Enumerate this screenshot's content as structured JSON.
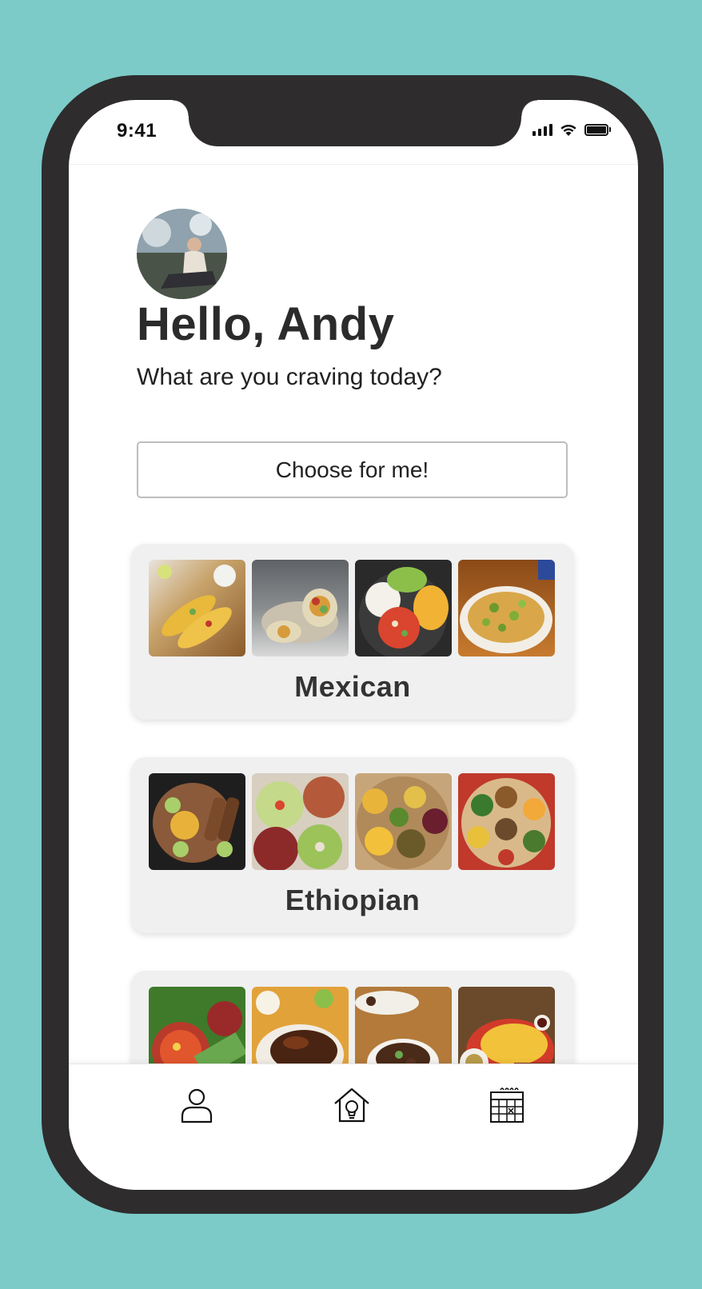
{
  "status_bar": {
    "time": "9:41"
  },
  "profile": {
    "greeting": "Hello, Andy",
    "prompt": "What are you craving today?"
  },
  "actions": {
    "choose_label": "Choose for me!"
  },
  "cuisines": [
    {
      "name": "Mexican",
      "photos": [
        "tacos",
        "burrito",
        "salsa bowl",
        "nachos"
      ]
    },
    {
      "name": "Ethiopian",
      "photos": [
        "injera platter",
        "lentils and salad",
        "injera combo",
        "mixed platter"
      ]
    },
    {
      "name": "",
      "photos": [
        "banana leaf dish",
        "grilled chicken",
        "stew",
        "rice plate"
      ]
    }
  ],
  "tab_bar": {
    "items": [
      "profile-icon",
      "home-bulb-icon",
      "calendar-icon"
    ]
  },
  "colors": {
    "background": "#7ccbc8",
    "phone_frame": "#2e2c2d",
    "card": "#f0f0f0",
    "text": "#2b2b2b"
  }
}
